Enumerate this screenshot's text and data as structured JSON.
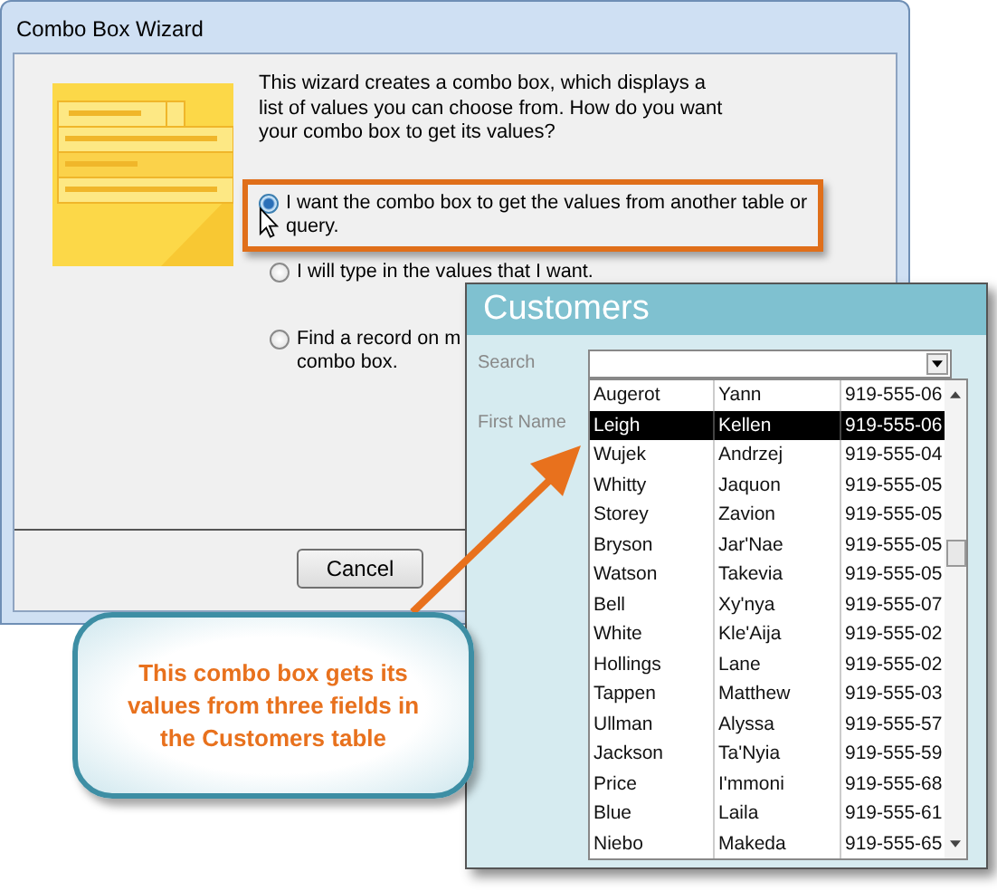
{
  "wizard": {
    "title": "Combo Box Wizard",
    "intro": "This wizard creates a combo box, which displays a list of values you can choose from.  How do you want your combo box to get its values?",
    "options": [
      {
        "lines": [
          "I want the combo box to get the values from another table or",
          "query."
        ],
        "selected": true,
        "highlighted": true
      },
      {
        "lines": [
          "I will type in the values that I want."
        ],
        "selected": false
      },
      {
        "lines": [
          "Find a record on m",
          "combo box."
        ],
        "selected": false
      }
    ],
    "cancel_button": "Cancel"
  },
  "customers_form": {
    "title": "Customers",
    "search_label": "Search",
    "first_name_label": "First Name",
    "rows": [
      {
        "cells": [
          "Augerot",
          "Yann",
          "919-555-06"
        ],
        "selected": false
      },
      {
        "cells": [
          "Leigh",
          "Kellen",
          "919-555-06"
        ],
        "selected": true
      },
      {
        "cells": [
          "Wujek",
          "Andrzej",
          "919-555-04"
        ],
        "selected": false
      },
      {
        "cells": [
          "Whitty",
          "Jaquon",
          "919-555-05"
        ],
        "selected": false
      },
      {
        "cells": [
          "Storey",
          "Zavion",
          "919-555-05"
        ],
        "selected": false
      },
      {
        "cells": [
          "Bryson",
          "Jar'Nae",
          "919-555-05"
        ],
        "selected": false
      },
      {
        "cells": [
          "Watson",
          "Takevia",
          "919-555-05"
        ],
        "selected": false
      },
      {
        "cells": [
          "Bell",
          "Xy'nya",
          "919-555-07"
        ],
        "selected": false
      },
      {
        "cells": [
          "White",
          "Kle'Aija",
          "919-555-02"
        ],
        "selected": false
      },
      {
        "cells": [
          "Hollings",
          "Lane",
          "919-555-02"
        ],
        "selected": false
      },
      {
        "cells": [
          "Tappen",
          "Matthew",
          "919-555-03"
        ],
        "selected": false
      },
      {
        "cells": [
          "Ullman",
          "Alyssa",
          "919-555-57"
        ],
        "selected": false
      },
      {
        "cells": [
          "Jackson",
          "Ta'Nyia",
          "919-555-59"
        ],
        "selected": false
      },
      {
        "cells": [
          "Price",
          "I'mmoni",
          "919-555-68"
        ],
        "selected": false
      },
      {
        "cells": [
          "Blue",
          "Laila",
          "919-555-61"
        ],
        "selected": false
      },
      {
        "cells": [
          "Niebo",
          "Makeda",
          "919-555-65"
        ],
        "selected": false
      }
    ]
  },
  "callout": {
    "text": "This combo box gets its values from three fields in the Customers table"
  }
}
